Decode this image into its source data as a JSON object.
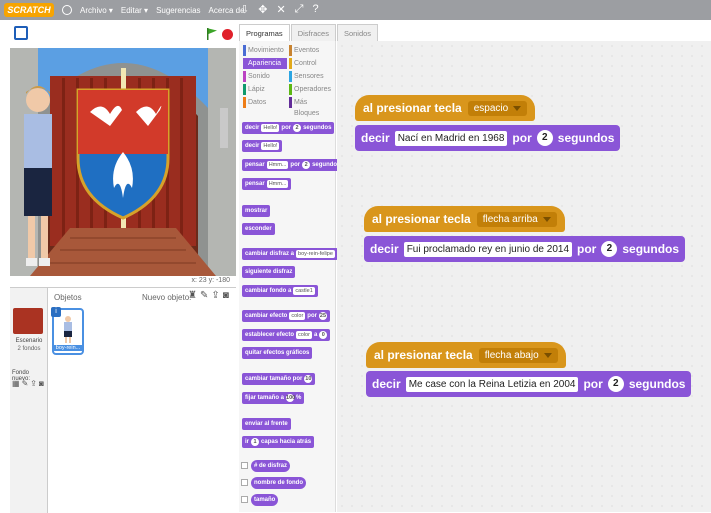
{
  "menubar": {
    "logo": "SCRATCH",
    "items": [
      "Archivo ▾",
      "Editar ▾",
      "Sugerencias",
      "Acerca de"
    ],
    "tools": [
      "⇩",
      "✥",
      "✕",
      "⤢",
      "?"
    ]
  },
  "stage": {
    "coords": "x: 23   y: -180"
  },
  "sprites": {
    "objetos_label": "Objetos",
    "nuevo_label": "Nuevo objeto:",
    "stage_label": "Escenario",
    "stage_sub": "2 fondos",
    "backdrop_label": "Fondo nuevo:",
    "sprite_badge": "i",
    "sprite_name": "boy-rein..."
  },
  "tabs": [
    "Programas",
    "Disfraces",
    "Sonidos"
  ],
  "categories": [
    {
      "label": "Movimiento",
      "color": "#4a6cd4"
    },
    {
      "label": "Eventos",
      "color": "#c88330"
    },
    {
      "label": "Apariencia",
      "color": "#8a55d7"
    },
    {
      "label": "Control",
      "color": "#e1a91a"
    },
    {
      "label": "Sonido",
      "color": "#bb42c3"
    },
    {
      "label": "Sensores",
      "color": "#2ca5e2"
    },
    {
      "label": "Lápiz",
      "color": "#0e9a6c"
    },
    {
      "label": "Operadores",
      "color": "#5cb712"
    },
    {
      "label": "Datos",
      "color": "#ee7d16"
    },
    {
      "label": "Más Bloques",
      "color": "#632d99"
    }
  ],
  "palette_blocks": {
    "b1_a": "decir",
    "b1_in": "Hello!",
    "b1_b": "por",
    "b1_n": "2",
    "b1_c": "segundos",
    "b2_a": "decir",
    "b2_in": "Hello!",
    "b3_a": "pensar",
    "b3_in": "Hmm...",
    "b3_b": "por",
    "b3_n": "2",
    "b3_c": "segundos",
    "b4_a": "pensar",
    "b4_in": "Hmm...",
    "b5": "mostrar",
    "b6": "esconder",
    "b7_a": "cambiar disfraz a",
    "b7_in": "boy-rein-felipe",
    "b8": "siguiente disfraz",
    "b9_a": "cambiar fondo a",
    "b9_in": "castle1",
    "b10_a": "cambiar efecto",
    "b10_in": "color",
    "b10_b": "por",
    "b10_n": "25",
    "b11_a": "establecer efecto",
    "b11_in": "color",
    "b11_b": "a",
    "b11_n": "0",
    "b12": "quitar efectos gráficos",
    "b13_a": "cambiar tamaño por",
    "b13_n": "10",
    "b14_a": "fijar tamaño a",
    "b14_n": "100",
    "b14_b": "%",
    "b15": "enviar al frente",
    "b16_a": "ir",
    "b16_n": "1",
    "b16_b": "capas hacia atrás",
    "b17": "# de disfraz",
    "b18": "nombre de fondo",
    "b19": "tamaño"
  },
  "scripts": [
    {
      "hat": "al presionar tecla",
      "key": "espacio",
      "say": "decir",
      "text": "Nací en Madrid en 1968",
      "por": "por",
      "secs": "2",
      "unit": "segundos"
    },
    {
      "hat": "al presionar tecla",
      "key": "flecha arriba",
      "say": "decir",
      "text": "Fui proclamado rey en junio de 2014",
      "por": "por",
      "secs": "2",
      "unit": "segundos"
    },
    {
      "hat": "al presionar tecla",
      "key": "flecha abajo",
      "say": "decir",
      "text": "Me case con la Reina Letizia en 2004",
      "por": "por",
      "secs": "2",
      "unit": "segundos"
    }
  ],
  "colors": {
    "looks": "#8a55d7",
    "events": "#d9961c",
    "menubar": "#9c9ea2"
  }
}
